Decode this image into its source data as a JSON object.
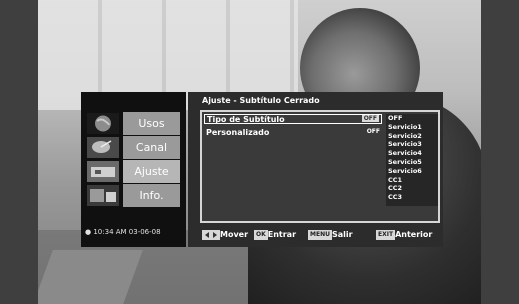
{
  "menu": {
    "title": "Ajuste - Subtítulo Cerrado",
    "sidebar": {
      "items": [
        {
          "label": "Usos",
          "icon": "globe-icon"
        },
        {
          "label": "Canal",
          "icon": "satellite-dish-icon"
        },
        {
          "label": "Ajuste",
          "icon": "settings-thumbnail-icon"
        },
        {
          "label": "Info.",
          "icon": "info-thumbnail-icon"
        }
      ],
      "active": "Ajuste",
      "clock": "10:34 AM 03-06-08"
    },
    "rows": [
      {
        "label": "Tipo de Subtítulo",
        "value": "OFF"
      },
      {
        "label": "Personalizado",
        "value": "OFF"
      }
    ],
    "options": [
      "OFF",
      "Servicio1",
      "Servicio2",
      "Servicio3",
      "Servicio4",
      "Servicio5",
      "Servicio6",
      "CC1",
      "CC2",
      "CC3"
    ],
    "footer": {
      "move": "Mover",
      "ok_key": "OK",
      "enter": "Entrar",
      "menu_key": "MENU",
      "exit_menu": "Salir",
      "exit_key": "EXIT",
      "previous": "Anterior"
    }
  }
}
